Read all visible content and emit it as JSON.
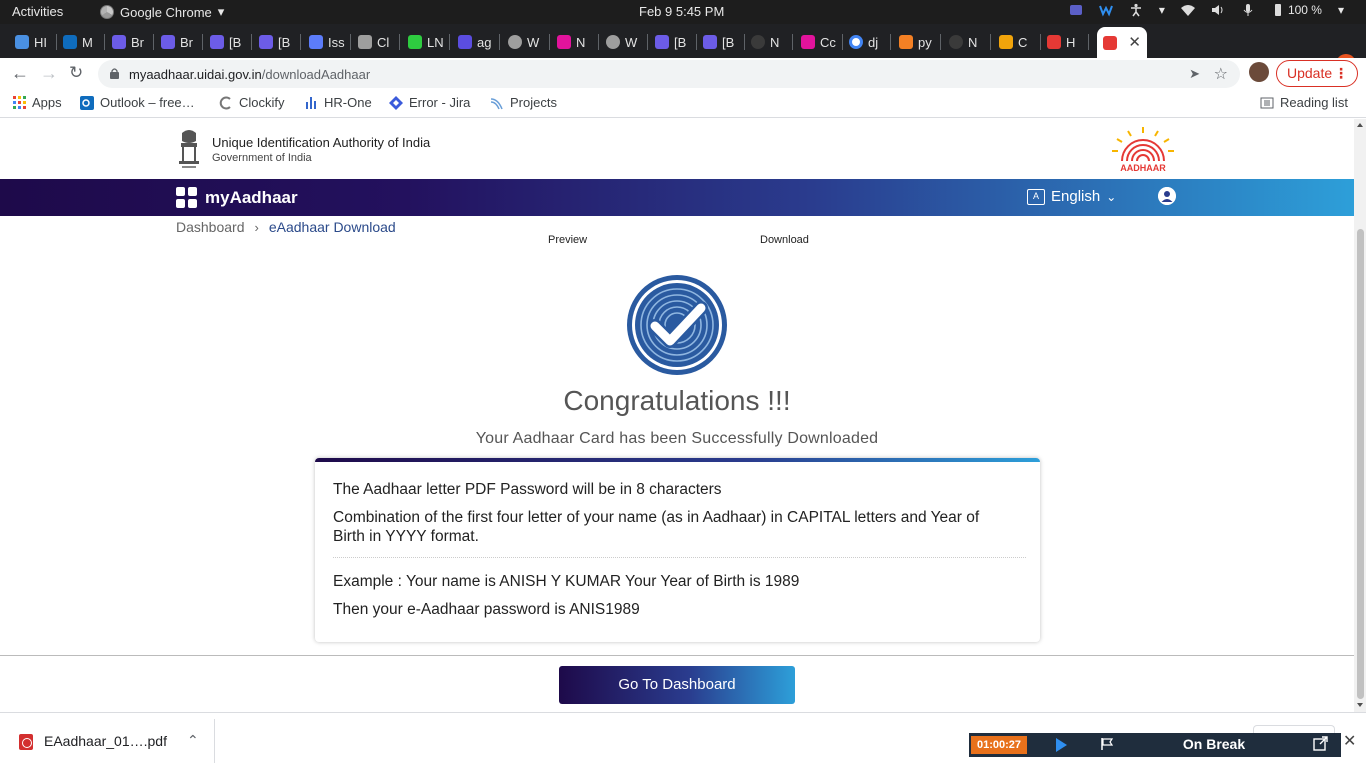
{
  "system_bar": {
    "activities": "Activities",
    "app_name": "Google Chrome",
    "clock": "Feb 9   5:45 PM",
    "battery": "100 %"
  },
  "tabs": [
    {
      "label": "HI",
      "icon": "hr-icon",
      "color": "#4a90e2"
    },
    {
      "label": "M",
      "icon": "outlook-icon",
      "color": "#0f6cbd"
    },
    {
      "label": "Br",
      "icon": "jira-icon",
      "color": "#6c5ce7"
    },
    {
      "label": "Br",
      "icon": "jira-icon",
      "color": "#6c5ce7"
    },
    {
      "label": "[B",
      "icon": "jira-icon",
      "color": "#6c5ce7"
    },
    {
      "label": "[B",
      "icon": "jira-icon",
      "color": "#6c5ce7"
    },
    {
      "label": "Iss",
      "icon": "issue-icon",
      "color": "#5c7cfa"
    },
    {
      "label": "Cl",
      "icon": "clockify-icon",
      "color": "#9e9e9e"
    },
    {
      "label": "LN",
      "icon": "ln-icon",
      "color": "#2ecc40"
    },
    {
      "label": "ag",
      "icon": "ag-icon",
      "color": "#5b4de0"
    },
    {
      "label": "W",
      "icon": "globe-icon",
      "color": "#9e9e9e"
    },
    {
      "label": "N",
      "icon": "xd-icon",
      "color": "#e2139c"
    },
    {
      "label": "W",
      "icon": "globe-icon",
      "color": "#9e9e9e"
    },
    {
      "label": "[B",
      "icon": "jira-icon",
      "color": "#6c5ce7"
    },
    {
      "label": "[B",
      "icon": "jira-icon",
      "color": "#6c5ce7"
    },
    {
      "label": "N",
      "icon": "github-icon",
      "color": "#3a3a3a"
    },
    {
      "label": "Cc",
      "icon": "xd-icon",
      "color": "#e2139c"
    },
    {
      "label": "dj",
      "icon": "google-icon",
      "color": "#ffffff"
    },
    {
      "label": "py",
      "icon": "stackoverflow-icon",
      "color": "#f48024"
    },
    {
      "label": "N",
      "icon": "github-icon",
      "color": "#3a3a3a"
    },
    {
      "label": "C",
      "icon": "codepen-icon",
      "color": "#f1a40b"
    },
    {
      "label": "H",
      "icon": "aadhaar-icon",
      "color": "#e53935"
    },
    {
      "label": "",
      "icon": "aadhaar-icon",
      "color": "#e53935",
      "active": true
    }
  ],
  "toolbar": {
    "url_host": "myaadhaar.uidai.gov.in",
    "url_path": "/downloadAadhaar",
    "update_label": "Update"
  },
  "bookmarks": [
    {
      "label": "Apps",
      "icon": "apps-grid-icon"
    },
    {
      "label": "Outlook – free…",
      "icon": "outlook-icon"
    },
    {
      "label": "Clockify",
      "icon": "clockify-icon"
    },
    {
      "label": "HR-One",
      "icon": "hr-one-icon"
    },
    {
      "label": "Error - Jira",
      "icon": "jira-icon"
    },
    {
      "label": "Projects",
      "icon": "projects-icon"
    }
  ],
  "reading_list": "Reading list",
  "header": {
    "org_name": "Unique Identification Authority of India",
    "gov_name": "Government of India",
    "logo_text": "AADHAAR"
  },
  "brandbar": {
    "brand": "myAadhaar",
    "language": "English"
  },
  "breadcrumb": {
    "home": "Dashboard",
    "current": "eAadhaar Download"
  },
  "steps": {
    "preview": "Preview",
    "download": "Download"
  },
  "main": {
    "title": "Congratulations !!!",
    "subtitle": "Your Aadhaar Card has been Successfully Downloaded",
    "info": {
      "line1": "The Aadhaar letter PDF Password will be in 8 characters",
      "line2": "Combination of the first four letter of your name (as in Aadhaar) in CAPITAL letters and Year of Birth in YYYY format.",
      "example1": "Example : Your name is ANISH Y KUMAR Your Year of Birth is 1989",
      "example2": "Then your e-Aadhaar password is ANIS1989"
    },
    "dashboard_button": "Go To Dashboard"
  },
  "download_shelf": {
    "file_name": "EAadhaar_01….pdf"
  },
  "timer": {
    "elapsed": "01:00:27",
    "status": "On Break"
  },
  "colors": {
    "brand_dark": "#1e0a4a",
    "brand_light": "#2d9fd9",
    "badge_blue": "#2a5aa0",
    "update_red": "#d93025"
  }
}
